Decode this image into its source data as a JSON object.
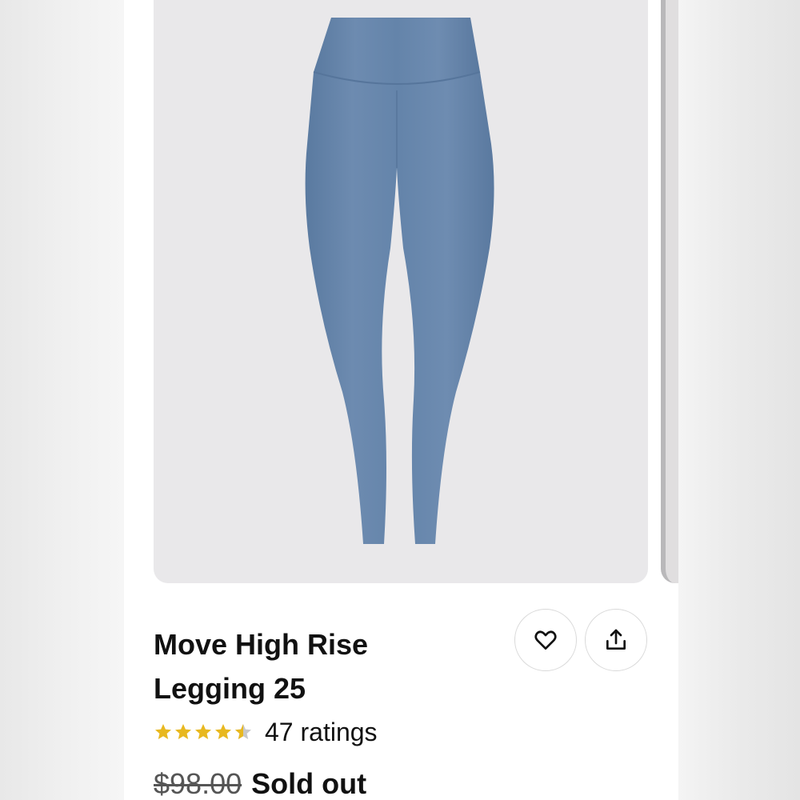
{
  "product": {
    "title_line1": "Move High Rise",
    "title_line2": "Legging 25",
    "rating": 4.5,
    "rating_max": 5,
    "ratings_label": "47 ratings",
    "original_price": "$98.00",
    "status": "Sold out",
    "image_color": "#6b89ad"
  },
  "actions": {
    "favorite_icon": "heart-icon",
    "share_icon": "share-icon"
  },
  "colors": {
    "star_filled": "#e8b820",
    "star_empty": "#c8c8c8",
    "image_background": "#e9e8ea",
    "text": "#111111"
  }
}
